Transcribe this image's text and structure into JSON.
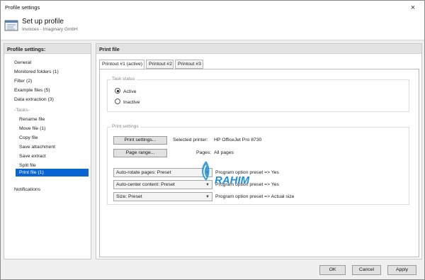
{
  "window": {
    "title": "Profile settings",
    "close_glyph": "×"
  },
  "header": {
    "title": "Set up profile",
    "subtitle": "Invoices - Imaginary GmbH",
    "icon": "profile-settings-icon"
  },
  "sidebar": {
    "heading": "Profile settings:",
    "items": [
      {
        "label": "General"
      },
      {
        "label": "Monitored folders (1)"
      },
      {
        "label": "Filter (2)"
      },
      {
        "label": "Example files (5)"
      },
      {
        "label": "Data extraction (3)"
      },
      {
        "label": "-Tasks-"
      },
      {
        "label": "Rename file"
      },
      {
        "label": "Move file (1)"
      },
      {
        "label": "Copy file"
      },
      {
        "label": "Save attachment"
      },
      {
        "label": "Save extract"
      },
      {
        "label": "Split file"
      },
      {
        "label": "Print file (1)",
        "selected": true
      },
      {
        "label": "Notifications"
      }
    ]
  },
  "main": {
    "heading": "Print file",
    "tabs": [
      {
        "label": "Printout #1 (active)",
        "active": true
      },
      {
        "label": "Printout #2"
      },
      {
        "label": "Printout #3"
      }
    ],
    "task_status": {
      "label": "Task status",
      "options": [
        {
          "label": "Active",
          "checked": true
        },
        {
          "label": "Inactive",
          "checked": false
        }
      ]
    },
    "print_settings": {
      "label": "Print settings",
      "print_settings_button": "Print settings...",
      "selected_printer_label": "Selected printer:",
      "selected_printer_value": "HP OfficeJet Pro 8730",
      "page_range_button": "Page range...",
      "pages_label": "Pages:",
      "pages_value": "All pages",
      "options": [
        {
          "select": "Auto-rotate pages: Preset",
          "note": "Program option preset => Yes"
        },
        {
          "select": "Auto-center content: Preset",
          "note": "Program option preset => Yes"
        },
        {
          "select": "Size: Preset",
          "note": "Program option preset => Actual size"
        }
      ]
    }
  },
  "footer": {
    "ok": "OK",
    "cancel": "Cancel",
    "apply": "Apply"
  },
  "watermark": {
    "text": "RAHIM",
    "color": "#1f8fd6"
  }
}
